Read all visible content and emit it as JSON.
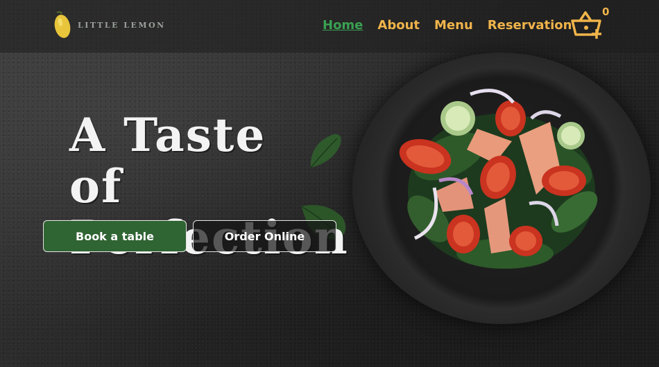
{
  "brand": {
    "name": "LITTLE LEMON",
    "accent": "#f0b44a",
    "active_color": "#3aa052"
  },
  "nav": {
    "items": [
      {
        "label": "Home",
        "active": true
      },
      {
        "label": "About",
        "active": false
      },
      {
        "label": "Menu",
        "active": false
      },
      {
        "label": "Reservation",
        "active": false
      }
    ]
  },
  "cart": {
    "icon": "basket-add-icon",
    "count": "0"
  },
  "hero": {
    "title_line1": "A Taste of",
    "title_line2": "Perfection",
    "image": "salad-plate-image"
  },
  "actions": {
    "book_label": "Book a table",
    "order_label": "Order Online"
  }
}
